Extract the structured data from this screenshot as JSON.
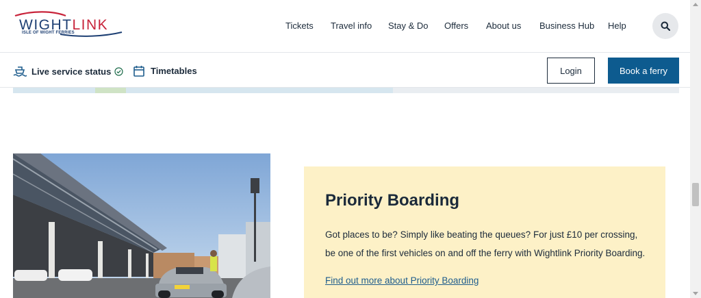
{
  "brand": {
    "word_1": "WIGHT",
    "word_2": "LINK",
    "tagline": "ISLE OF WIGHT FERRIES",
    "navy": "#1d3f73",
    "red": "#c8233a"
  },
  "nav": {
    "items": [
      "Tickets",
      "Travel info",
      "Stay & Do",
      "Offers",
      "About us",
      "Business Hub",
      "Help"
    ],
    "search_icon": "search-icon"
  },
  "subbar": {
    "live_status_label": "Live service status",
    "live_status_icon": "ferry-icon",
    "status_ok_icon": "check-circle-icon",
    "timetables_label": "Timetables",
    "timetables_icon": "calendar-icon",
    "login_label": "Login",
    "book_label": "Book a ferry",
    "book_color": "#0d5b8f"
  },
  "promo": {
    "title": "Priority Boarding",
    "body": "Got places to be? Simply like beating the queues? For just £10 per crossing, be one of the first vehicles on and off the ferry with Wightlink Priority Boarding.",
    "link": "Find out more about Priority Boarding",
    "background": "#fdf1c7"
  }
}
